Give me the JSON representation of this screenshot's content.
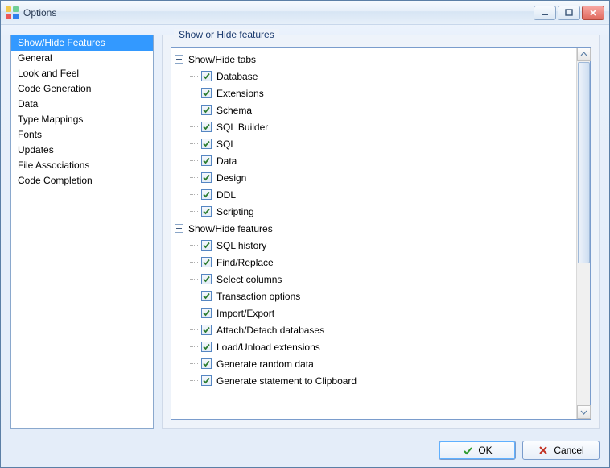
{
  "window": {
    "title": "Options"
  },
  "sidebar": {
    "items": [
      {
        "label": "Show/Hide Features",
        "selected": true
      },
      {
        "label": "General"
      },
      {
        "label": "Look and Feel"
      },
      {
        "label": "Code Generation"
      },
      {
        "label": "Data"
      },
      {
        "label": "Type Mappings"
      },
      {
        "label": "Fonts"
      },
      {
        "label": "Updates"
      },
      {
        "label": "File Associations"
      },
      {
        "label": "Code Completion"
      }
    ]
  },
  "group": {
    "label": "Show or Hide features"
  },
  "tree": [
    {
      "label": "Show/Hide tabs",
      "expanded": true,
      "children": [
        {
          "label": "Database",
          "checked": true
        },
        {
          "label": "Extensions",
          "checked": true
        },
        {
          "label": "Schema",
          "checked": true
        },
        {
          "label": "SQL Builder",
          "checked": true
        },
        {
          "label": "SQL",
          "checked": true
        },
        {
          "label": "Data",
          "checked": true
        },
        {
          "label": "Design",
          "checked": true
        },
        {
          "label": "DDL",
          "checked": true
        },
        {
          "label": "Scripting",
          "checked": true
        }
      ]
    },
    {
      "label": "Show/Hide features",
      "expanded": true,
      "children": [
        {
          "label": "SQL history",
          "checked": true
        },
        {
          "label": "Find/Replace",
          "checked": true
        },
        {
          "label": "Select columns",
          "checked": true
        },
        {
          "label": "Transaction options",
          "checked": true
        },
        {
          "label": "Import/Export",
          "checked": true
        },
        {
          "label": "Attach/Detach databases",
          "checked": true
        },
        {
          "label": "Load/Unload extensions",
          "checked": true
        },
        {
          "label": "Generate random data",
          "checked": true
        },
        {
          "label": "Generate statement to Clipboard",
          "checked": true
        }
      ]
    }
  ],
  "buttons": {
    "ok": "OK",
    "cancel": "Cancel"
  }
}
